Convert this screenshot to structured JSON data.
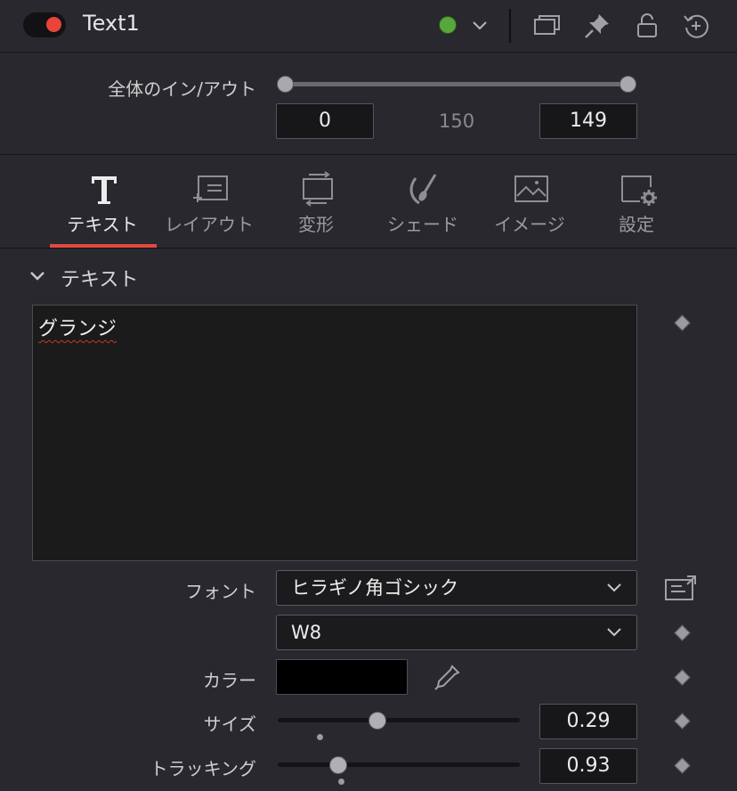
{
  "header": {
    "title": "Text1",
    "icons": [
      "toggle",
      "color-tag-dot",
      "chevron-down-icon",
      "versions-icon",
      "pin-icon",
      "lock-icon",
      "reset-icon"
    ]
  },
  "inout": {
    "label": "全体のイン/アウト",
    "in_value": "0",
    "duration": "150",
    "out_value": "149"
  },
  "tabs": [
    {
      "label": "テキスト",
      "icon": "text-t-icon",
      "active": true
    },
    {
      "label": "レイアウト",
      "icon": "layout-icon",
      "active": false
    },
    {
      "label": "変形",
      "icon": "transform-icon",
      "active": false
    },
    {
      "label": "シェード",
      "icon": "shade-brush-icon",
      "active": false
    },
    {
      "label": "イメージ",
      "icon": "image-icon",
      "active": false
    },
    {
      "label": "設定",
      "icon": "settings-icon",
      "active": false
    }
  ],
  "section": {
    "title": "テキスト",
    "styled_text": "グランジ"
  },
  "font": {
    "label": "フォント",
    "family": "ヒラギノ角ゴシック",
    "style": "W8"
  },
  "color": {
    "label": "カラー",
    "value": "#000000"
  },
  "size": {
    "label": "サイズ",
    "value": "0.29",
    "slider_fraction": 0.41
  },
  "tracking": {
    "label": "トラッキング",
    "value": "0.93",
    "slider_fraction": 0.25
  },
  "colors": {
    "accent": "#e04a3e",
    "toggle_red": "#e8443a",
    "tag_green": "#57a83a"
  }
}
